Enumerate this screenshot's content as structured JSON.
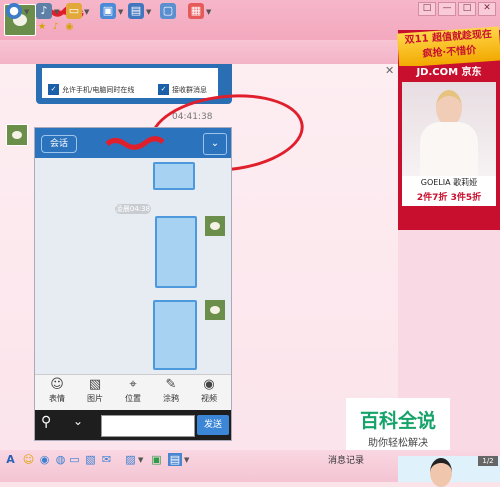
{
  "window": {
    "status_icons": "★ ♪ ◉",
    "controls": [
      "□",
      "—",
      "□",
      "✕"
    ]
  },
  "toolbar": {
    "icons": [
      "webcam-icon",
      "mic-icon",
      "folder-icon",
      "remote-icon",
      "screen-share-icon",
      "app-grid-icon"
    ]
  },
  "settings_snippet": {
    "checkbox1_label": "允许手机/电脑同时在线",
    "checkbox2_label": "接收群消息"
  },
  "chat": {
    "timestamp": "04:41:38"
  },
  "phone": {
    "back_label": "会话",
    "down_icon": "chevron-down-icon",
    "time_pill": "凌晨04:38",
    "actions": [
      {
        "icon": "☺",
        "label": "表情"
      },
      {
        "icon": "▧",
        "label": "图片"
      },
      {
        "icon": "⌖",
        "label": "位置"
      },
      {
        "icon": "✎",
        "label": "涂鸦"
      },
      {
        "icon": "◉",
        "label": "视频"
      }
    ],
    "send_label": "发送"
  },
  "ad": {
    "banner_line1": "双11 超值就趁现在",
    "banner_line2": "疯抢·不惜价",
    "store": "JD.COM 京东",
    "brand": "GOELIA 歌莉娅",
    "offer": "2件7折 3件5折"
  },
  "watermark": {
    "title": "百科全说",
    "subtitle": "助你轻松解决"
  },
  "bottom": {
    "record_label": "消息记录",
    "page_count": "1/2"
  },
  "colors": {
    "title_pink": "#f3a8be",
    "phone_blue": "#2c73bd",
    "annotation_red": "#e01f2d",
    "watermark_green": "#16a36a"
  }
}
